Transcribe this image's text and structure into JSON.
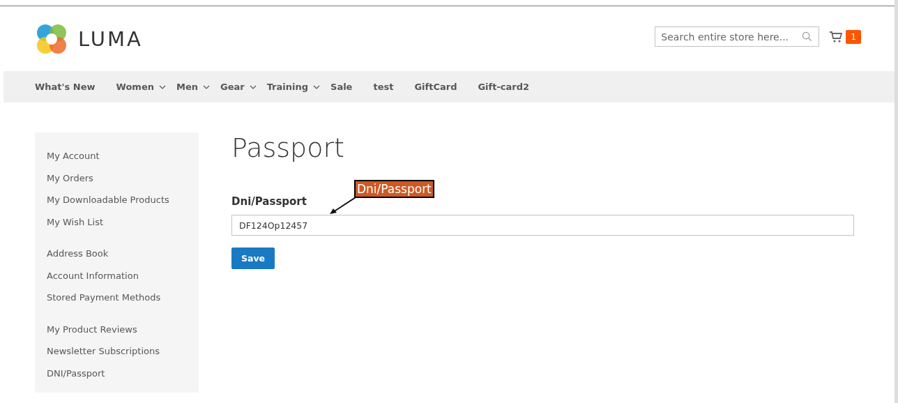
{
  "header": {
    "logo_text": "LUMA",
    "search": {
      "placeholder": "Search entire store here..."
    },
    "cart_count": "1"
  },
  "nav": [
    {
      "label": "What's New",
      "kind": "link"
    },
    {
      "label": "Women",
      "kind": "menu"
    },
    {
      "label": "Men",
      "kind": "menu"
    },
    {
      "label": "Gear",
      "kind": "menu"
    },
    {
      "label": "Training",
      "kind": "menu"
    },
    {
      "label": "Sale",
      "kind": "link"
    },
    {
      "label": "test",
      "kind": "link"
    },
    {
      "label": "GiftCard",
      "kind": "link"
    },
    {
      "label": "Gift-card2",
      "kind": "link"
    }
  ],
  "sidebar": {
    "groups": [
      {
        "items": [
          "My Account",
          "My Orders",
          "My Downloadable Products",
          "My Wish List"
        ]
      },
      {
        "items": [
          "Address Book",
          "Account Information",
          "Stored Payment Methods"
        ]
      },
      {
        "items": [
          "My Product Reviews",
          "Newsletter Subscriptions",
          "DNI/Passport"
        ]
      }
    ]
  },
  "page_title": "Passport",
  "form": {
    "label": "Dni/Passport",
    "value": "DF124Op12457",
    "button": "Save"
  },
  "annotation": {
    "text": "Dni/Passport"
  }
}
